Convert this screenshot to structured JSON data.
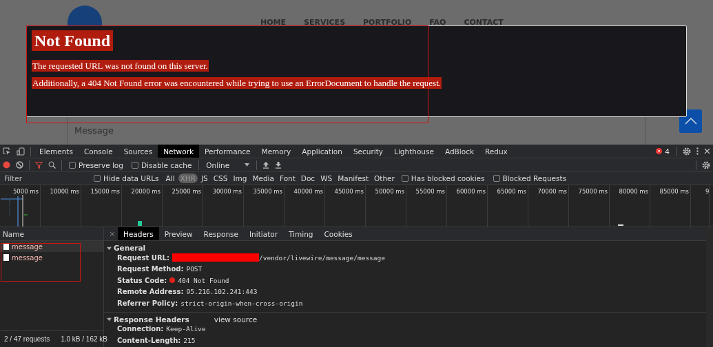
{
  "website": {
    "nav": [
      "HOME",
      "SERVICES",
      "PORTFOLIO",
      "FAQ",
      "CONTACT"
    ],
    "message_placeholder": "Message"
  },
  "error_page": {
    "title": "Not Found",
    "lines": [
      "The requested URL was not found on this server.",
      "Additionally, a 404 Not Found error was encountered while trying to use an ErrorDocument to handle the request."
    ]
  },
  "devtools": {
    "tabs": [
      {
        "label": "Elements",
        "selected": false
      },
      {
        "label": "Console",
        "selected": false
      },
      {
        "label": "Sources",
        "selected": false
      },
      {
        "label": "Network",
        "selected": true
      },
      {
        "label": "Performance",
        "selected": false
      },
      {
        "label": "Memory",
        "selected": false
      },
      {
        "label": "Application",
        "selected": false
      },
      {
        "label": "Security",
        "selected": false
      },
      {
        "label": "Lighthouse",
        "selected": false
      },
      {
        "label": "AdBlock",
        "selected": false
      },
      {
        "label": "Redux",
        "selected": false
      }
    ],
    "error_count": "4",
    "toolbar": {
      "recording": true,
      "preserve_log": {
        "label": "Preserve log",
        "checked": false
      },
      "disable_cache": {
        "label": "Disable cache",
        "checked": false
      },
      "throttling": "Online"
    },
    "filter": {
      "placeholder": "Filter",
      "hide_data_urls": {
        "label": "Hide data URLs",
        "checked": false
      },
      "types": [
        {
          "label": "All",
          "selected": false
        },
        {
          "label": "XHR",
          "selected": true
        },
        {
          "label": "JS",
          "selected": false
        },
        {
          "label": "CSS",
          "selected": false
        },
        {
          "label": "Img",
          "selected": false
        },
        {
          "label": "Media",
          "selected": false
        },
        {
          "label": "Font",
          "selected": false
        },
        {
          "label": "Doc",
          "selected": false
        },
        {
          "label": "WS",
          "selected": false
        },
        {
          "label": "Manifest",
          "selected": false
        },
        {
          "label": "Other",
          "selected": false
        }
      ],
      "has_blocked_cookies": {
        "label": "Has blocked cookies",
        "checked": false
      },
      "blocked_requests": {
        "label": "Blocked Requests",
        "checked": false
      }
    },
    "overview_ticks": [
      "5000 ms",
      "10000 ms",
      "15000 ms",
      "20000 ms",
      "25000 ms",
      "30000 ms",
      "35000 ms",
      "40000 ms",
      "45000 ms",
      "50000 ms",
      "55000 ms",
      "60000 ms",
      "65000 ms",
      "70000 ms",
      "75000 ms",
      "80000 ms",
      "85000 ms",
      "9"
    ],
    "name_header": "Name",
    "requests": [
      {
        "name": "message",
        "selected": true
      },
      {
        "name": "message",
        "selected": false
      }
    ],
    "detail_tabs": [
      {
        "label": "Headers",
        "selected": true
      },
      {
        "label": "Preview",
        "selected": false
      },
      {
        "label": "Response",
        "selected": false
      },
      {
        "label": "Initiator",
        "selected": false
      },
      {
        "label": "Timing",
        "selected": false
      },
      {
        "label": "Cookies",
        "selected": false
      }
    ],
    "general": {
      "title": "General",
      "expanded": true,
      "rows": [
        {
          "key": "Request URL:",
          "value": "/vendor/livewire/message/message",
          "redacted": true,
          "error_dot": false
        },
        {
          "key": "Request Method:",
          "value": "POST",
          "redacted": false,
          "error_dot": false
        },
        {
          "key": "Status Code:",
          "value": "404 Not Found",
          "redacted": false,
          "error_dot": true
        },
        {
          "key": "Remote Address:",
          "value": "95.216.102.241:443",
          "redacted": false,
          "error_dot": false
        },
        {
          "key": "Referrer Policy:",
          "value": "strict-origin-when-cross-origin",
          "redacted": false,
          "error_dot": false
        }
      ]
    },
    "response_headers": {
      "title": "Response Headers",
      "expanded": true,
      "link": "view source",
      "rows": [
        {
          "key": "Connection:",
          "value": "Keep-Alive"
        },
        {
          "key": "Content-Length:",
          "value": "215"
        }
      ]
    },
    "status": {
      "requests": "2 / 47 requests",
      "transferred": "1.0 kB / 162 kB"
    }
  }
}
